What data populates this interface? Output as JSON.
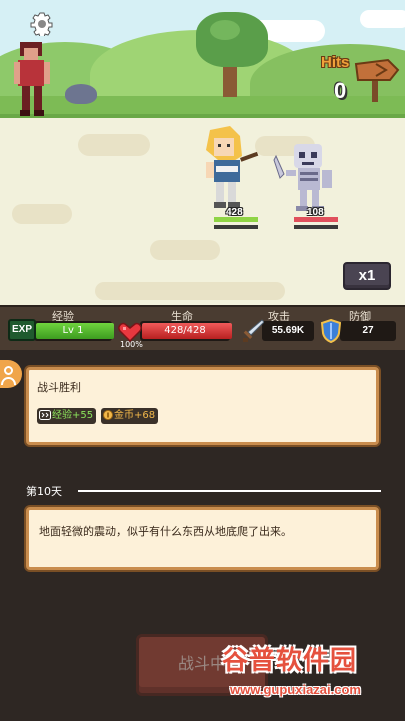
{
  "hud": {
    "hits_label": "Hits",
    "hits_count": "0",
    "speed_label": "x1"
  },
  "battle": {
    "hero_hp": "428",
    "enemy_hp": "108",
    "hero_hp_fraction": 1.0,
    "enemy_hp_fraction": 1.0
  },
  "stats": {
    "exp_title": "经验",
    "exp_badge": "EXP",
    "level": "Lv 1",
    "exp_fraction": 1.0,
    "life_title": "生命",
    "life_value": "428/428",
    "life_percent": "100%",
    "life_fraction": 1.0,
    "attack_title": "攻击",
    "attack_value": "55.69K",
    "defense_title": "防御",
    "defense_value": "27"
  },
  "log": {
    "victory_title": "战斗胜利",
    "exp_reward": "经验+55",
    "gold_reward": "金币+68",
    "day_label": "第10天",
    "event_text": "地面轻微的震动，似乎有什么东西从地底爬了出来。"
  },
  "fight_button_label": "战斗中",
  "watermark": {
    "title": "谷普软件园",
    "url": "www.gupuxiazai.com"
  },
  "colors": {
    "hp_green": "#8fd445",
    "hp_red": "#e0505c",
    "card_bg": "#fdf1d9",
    "card_border": "#c98d4e",
    "log_bg": "#2e2723",
    "stats_bg": "#4a3c31",
    "fight_button": "#a84a3e",
    "watermark_red": "#e5513e"
  },
  "icons": {
    "settings": "gear-icon",
    "sign": "signpost-icon",
    "life": "heart-icon",
    "attack": "sword-icon",
    "defense": "shield-icon",
    "avatar": "user-icon",
    "exp_reward": "exp-icon",
    "gold_reward": "coin-icon"
  }
}
